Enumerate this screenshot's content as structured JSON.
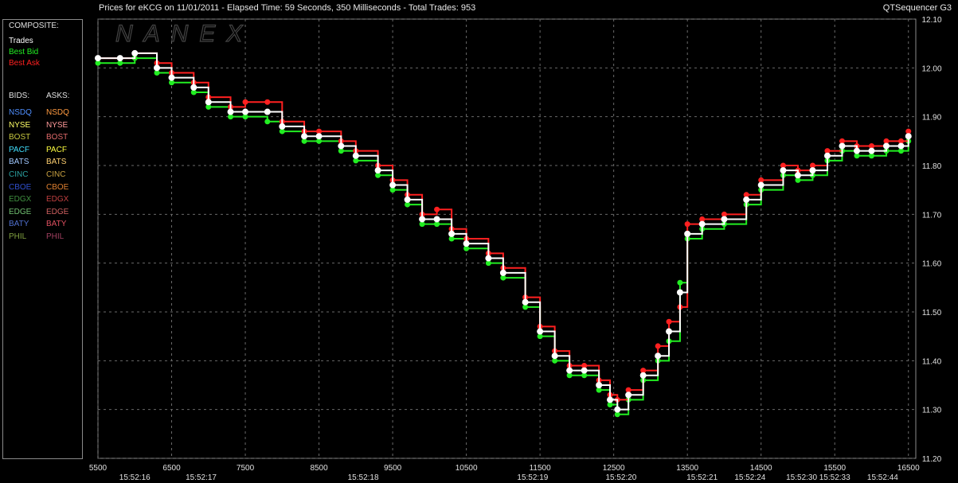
{
  "header": {
    "title": "Prices for  eKCG  on  11/01/2011  -  Elapsed Time: 59 Seconds, 350 Milliseconds  -  Total Trades: 953",
    "app_name": "QTSequencer G3"
  },
  "watermark": "NANEX",
  "legend": {
    "composite_label": "COMPOSITE:",
    "composite": [
      {
        "label": "Trades",
        "color": "#ffffff"
      },
      {
        "label": "Best Bid",
        "color": "#22ee22"
      },
      {
        "label": "Best Ask",
        "color": "#ff2020"
      }
    ],
    "bids_label": "BIDS:",
    "asks_label": "ASKS:",
    "exchanges": [
      {
        "bid": "NSDQ",
        "ask": "NSDQ",
        "bid_color": "#4f8fff",
        "ask_color": "#ff9a40"
      },
      {
        "bid": "NYSE",
        "ask": "NYSE",
        "bid_color": "#ffff66",
        "ask_color": "#ff9a9a"
      },
      {
        "bid": "BOST",
        "ask": "BOST",
        "bid_color": "#c8c840",
        "ask_color": "#e06a6a"
      },
      {
        "bid": "PACF",
        "ask": "PACF",
        "bid_color": "#40e0ff",
        "ask_color": "#ffff40"
      },
      {
        "bid": "BATS",
        "ask": "BATS",
        "bid_color": "#a0c8ff",
        "ask_color": "#ffd070"
      },
      {
        "bid": "CINC",
        "ask": "CINC",
        "bid_color": "#2aa0a0",
        "ask_color": "#c8a040"
      },
      {
        "bid": "CBOE",
        "ask": "CBOE",
        "bid_color": "#3050d0",
        "ask_color": "#e08030"
      },
      {
        "bid": "EDGX",
        "ask": "EDGX",
        "bid_color": "#409040",
        "ask_color": "#c04040"
      },
      {
        "bid": "EDGE",
        "ask": "EDGE",
        "bid_color": "#70c070",
        "ask_color": "#d06060"
      },
      {
        "bid": "BATY",
        "ask": "BATY",
        "bid_color": "#5070d0",
        "ask_color": "#e05060"
      },
      {
        "bid": "PHIL",
        "ask": "PHIL",
        "bid_color": "#80a040",
        "ask_color": "#a04060"
      }
    ]
  },
  "chart_data": {
    "type": "line",
    "title": "Prices for  eKCG  on  11/01/2011  -  Elapsed Time: 59 Seconds, 350 Milliseconds  -  Total Trades: 953",
    "x_ticks": [
      5500,
      6500,
      7500,
      8500,
      9500,
      10500,
      11500,
      12500,
      13500,
      14500,
      15500,
      16500
    ],
    "x_tick_labels": [
      "5500",
      "6500",
      "7500",
      "8500",
      "9500",
      "10500",
      "11500",
      "12500",
      "13500",
      "14500",
      "15500",
      "16500"
    ],
    "xlim": [
      5500,
      16600
    ],
    "y_ticks": [
      11.2,
      11.3,
      11.4,
      11.5,
      11.6,
      11.7,
      11.8,
      11.9,
      12.0,
      12.1
    ],
    "y_tick_labels": [
      "11.20",
      "11.30",
      "11.40",
      "11.50",
      "11.60",
      "11.70",
      "11.80",
      "11.90",
      "12.00",
      "12.10"
    ],
    "ylim": [
      11.2,
      12.1
    ],
    "grid": true,
    "time_labels": [
      {
        "x": 6000,
        "label": "15:52:16"
      },
      {
        "x": 6900,
        "label": "15:52:17"
      },
      {
        "x": 9100,
        "label": "15:52:18"
      },
      {
        "x": 11400,
        "label": "15:52:19"
      },
      {
        "x": 12600,
        "label": "15:52:20"
      },
      {
        "x": 13700,
        "label": "15:52:21"
      },
      {
        "x": 14350,
        "label": "15:52:24"
      },
      {
        "x": 15050,
        "label": "15:52:30"
      },
      {
        "x": 15500,
        "label": "15:52:33"
      },
      {
        "x": 16150,
        "label": "15:52:44"
      }
    ],
    "series": [
      {
        "name": "Trades",
        "color": "#ffffff",
        "x": [
          5500,
          5800,
          6000,
          6300,
          6500,
          6800,
          7000,
          7300,
          7500,
          7800,
          8000,
          8300,
          8500,
          8800,
          9000,
          9300,
          9500,
          9700,
          9900,
          10100,
          10300,
          10500,
          10800,
          11000,
          11300,
          11500,
          11700,
          11900,
          12100,
          12300,
          12450,
          12550,
          12700,
          12900,
          13100,
          13250,
          13400,
          13500,
          13700,
          14000,
          14300,
          14500,
          14800,
          15000,
          15200,
          15400,
          15600,
          15800,
          16000,
          16200,
          16400,
          16500
        ],
        "y": [
          12.02,
          12.02,
          12.03,
          12.0,
          11.98,
          11.96,
          11.93,
          11.91,
          11.91,
          11.91,
          11.88,
          11.86,
          11.86,
          11.84,
          11.82,
          11.79,
          11.76,
          11.73,
          11.69,
          11.69,
          11.66,
          11.64,
          11.61,
          11.58,
          11.52,
          11.46,
          11.41,
          11.38,
          11.38,
          11.35,
          11.32,
          11.3,
          11.33,
          11.37,
          11.41,
          11.46,
          11.54,
          11.66,
          11.68,
          11.69,
          11.73,
          11.76,
          11.79,
          11.78,
          11.79,
          11.82,
          11.84,
          11.83,
          11.83,
          11.84,
          11.84,
          11.86
        ]
      },
      {
        "name": "Best Bid",
        "color": "#22ee22",
        "x": [
          5500,
          5800,
          6000,
          6300,
          6500,
          6800,
          7000,
          7300,
          7500,
          7800,
          8000,
          8300,
          8500,
          8800,
          9000,
          9300,
          9500,
          9700,
          9900,
          10100,
          10300,
          10500,
          10800,
          11000,
          11300,
          11500,
          11700,
          11900,
          12100,
          12300,
          12450,
          12550,
          12700,
          12900,
          13100,
          13250,
          13400,
          13500,
          13700,
          14000,
          14300,
          14500,
          14800,
          15000,
          15200,
          15400,
          15600,
          15800,
          16000,
          16200,
          16400,
          16500
        ],
        "y": [
          12.01,
          12.01,
          12.02,
          11.99,
          11.97,
          11.95,
          11.92,
          11.9,
          11.9,
          11.89,
          11.87,
          11.85,
          11.85,
          11.83,
          11.81,
          11.78,
          11.75,
          11.72,
          11.68,
          11.68,
          11.65,
          11.63,
          11.6,
          11.57,
          11.51,
          11.45,
          11.4,
          11.37,
          11.37,
          11.34,
          11.31,
          11.29,
          11.32,
          11.36,
          11.4,
          11.44,
          11.56,
          11.65,
          11.67,
          11.68,
          11.72,
          11.75,
          11.78,
          11.77,
          11.78,
          11.81,
          11.83,
          11.82,
          11.82,
          11.83,
          11.83,
          11.85
        ]
      },
      {
        "name": "Best Ask",
        "color": "#ff2020",
        "x": [
          5500,
          5800,
          6000,
          6300,
          6500,
          6800,
          7000,
          7300,
          7500,
          7800,
          8000,
          8300,
          8500,
          8800,
          9000,
          9300,
          9500,
          9700,
          9900,
          10100,
          10300,
          10500,
          10800,
          11000,
          11300,
          11500,
          11700,
          11900,
          12100,
          12300,
          12450,
          12550,
          12700,
          12900,
          13100,
          13250,
          13400,
          13500,
          13700,
          14000,
          14300,
          14500,
          14800,
          15000,
          15200,
          15400,
          15600,
          15800,
          16000,
          16200,
          16400,
          16500
        ],
        "y": [
          12.02,
          12.02,
          12.03,
          12.01,
          11.99,
          11.97,
          11.94,
          11.92,
          11.93,
          11.93,
          11.89,
          11.87,
          11.87,
          11.85,
          11.83,
          11.8,
          11.77,
          11.74,
          11.7,
          11.71,
          11.67,
          11.65,
          11.62,
          11.59,
          11.53,
          11.47,
          11.42,
          11.39,
          11.39,
          11.36,
          11.33,
          11.32,
          11.34,
          11.38,
          11.43,
          11.48,
          11.51,
          11.68,
          11.69,
          11.7,
          11.74,
          11.77,
          11.8,
          11.79,
          11.8,
          11.83,
          11.85,
          11.84,
          11.84,
          11.85,
          11.85,
          11.87
        ]
      }
    ]
  }
}
